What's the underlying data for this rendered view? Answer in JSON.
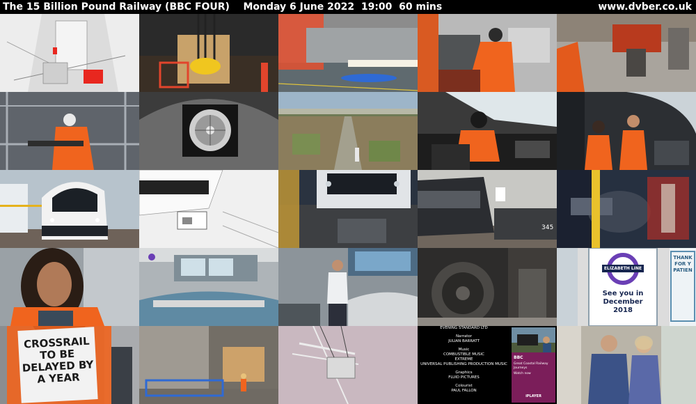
{
  "header": {
    "programme": "The 15 Billion Pound Railway (BBC FOUR)",
    "schedule": "Monday 6 June 2022  19:00  60 mins",
    "site": "www.dvber.co.uk"
  },
  "frames": [
    {
      "id": 1,
      "scene": "cad-render-room"
    },
    {
      "id": 2,
      "scene": "chain-hoist"
    },
    {
      "id": 3,
      "scene": "workshop-floor"
    },
    {
      "id": 4,
      "scene": "worker-in-cab"
    },
    {
      "id": 5,
      "scene": "red-machinery"
    },
    {
      "id": 6,
      "scene": "worker-on-scaffold"
    },
    {
      "id": 7,
      "scene": "tunnel-fan"
    },
    {
      "id": 8,
      "scene": "london-aerial"
    },
    {
      "id": 9,
      "scene": "driver-cab"
    },
    {
      "id": 10,
      "scene": "two-drivers"
    },
    {
      "id": 11,
      "scene": "train-front"
    },
    {
      "id": 12,
      "scene": "coupler-render"
    },
    {
      "id": 13,
      "scene": "train-nose"
    },
    {
      "id": 14,
      "scene": "train-side"
    },
    {
      "id": 15,
      "scene": "machinery-closeup"
    },
    {
      "id": 16,
      "scene": "woman-interview"
    },
    {
      "id": 17,
      "scene": "control-room"
    },
    {
      "id": 18,
      "scene": "man-in-control-room"
    },
    {
      "id": 19,
      "scene": "train-wheel"
    },
    {
      "id": 20,
      "scene": "elizabeth-line-sign"
    },
    {
      "id": 21,
      "scene": "crossrail-placard"
    },
    {
      "id": 22,
      "scene": "station-construction"
    },
    {
      "id": 23,
      "scene": "crane-tower"
    },
    {
      "id": 24,
      "scene": "credits"
    },
    {
      "id": 25,
      "scene": "couple-doorway"
    }
  ],
  "sign": {
    "line_name": "ELIZABETH LINE",
    "message": "See you in December 2018",
    "side_text": "THANK FOR Y PATIEN"
  },
  "placard": {
    "text": "CROSSRAIL TO BE DELAYED BY A YEAR"
  },
  "credits": {
    "heading": "EVENING STANDARD LTD",
    "narrator_title": "Narrator",
    "narrator": "JULIAN BARRATT",
    "music_title": "Music",
    "music_lines": [
      "COMBUSTIBLE MUSIC",
      "EXTREME",
      "UNIVERSAL PUBLISHING PRODUCTION MUSIC"
    ],
    "graphics_title": "Graphics",
    "graphics": "FLUID PICTURES",
    "colourist_title": "Colourist",
    "colourist": "PAUL FALLON",
    "promo_logo": "BBC",
    "promo_title": "Great Coastal Railway Journeys",
    "promo_sub": "Watch now",
    "promo_player": "iPLAYER"
  },
  "colors": {
    "hi_vis_orange": "#f0641e",
    "elizabeth_purple": "#6a3fb5",
    "header_text": "#ffffff"
  }
}
